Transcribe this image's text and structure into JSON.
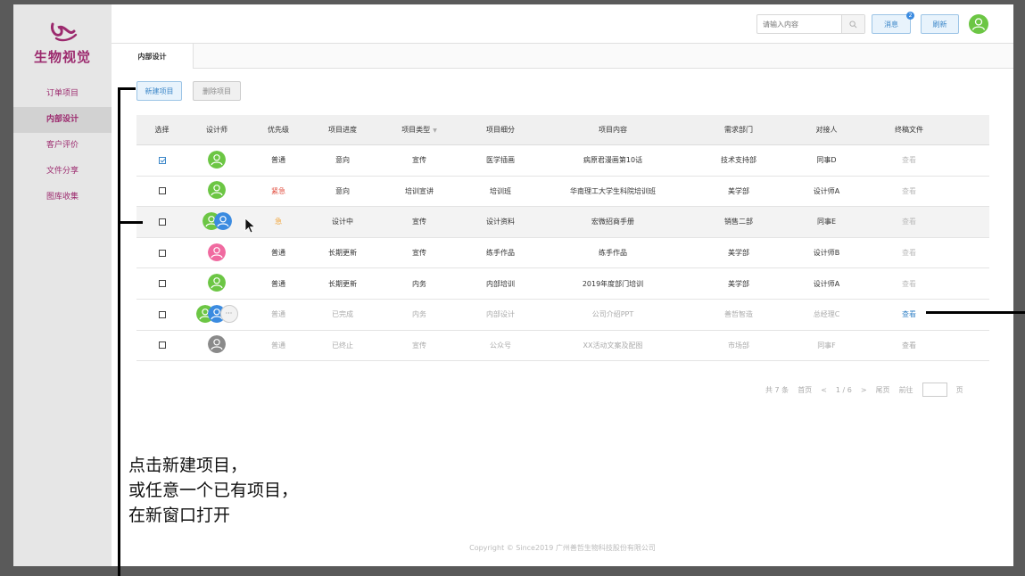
{
  "brand": {
    "name": "生物视觉",
    "color": "#9c2a6e"
  },
  "sidebar": {
    "items": [
      {
        "label": "订单项目",
        "active": false
      },
      {
        "label": "内部设计",
        "active": true
      },
      {
        "label": "客户评价",
        "active": false
      },
      {
        "label": "文件分享",
        "active": false
      },
      {
        "label": "图库收集",
        "active": false
      }
    ]
  },
  "topbar": {
    "search_placeholder": "请输入内容",
    "message_label": "消息",
    "message_badge": "2",
    "refresh_label": "刷新"
  },
  "tabs": [
    {
      "label": "内部设计"
    }
  ],
  "actions": {
    "new_label": "新建项目",
    "delete_label": "删除项目"
  },
  "table": {
    "headers": [
      "选择",
      "设计师",
      "优先级",
      "项目进度",
      "项目类型",
      "项目细分",
      "项目内容",
      "需求部门",
      "对接人",
      "终稿文件"
    ],
    "rows": [
      {
        "checked": true,
        "priority": "普通",
        "progress": "意向",
        "type": "宣传",
        "sub": "医学插画",
        "content": "病原君漫画第10话",
        "dept": "技术支持部",
        "contact": "同事D",
        "file": "查看"
      },
      {
        "checked": false,
        "priority": "紧急",
        "progress": "意向",
        "type": "培训宣讲",
        "sub": "培训班",
        "content": "华南理工大学生科院培训班",
        "dept": "美学部",
        "contact": "设计师A",
        "file": "查看"
      },
      {
        "checked": false,
        "priority": "急",
        "progress": "设计中",
        "type": "宣传",
        "sub": "设计资料",
        "content": "宏微招商手册",
        "dept": "销售二部",
        "contact": "同事E",
        "file": "查看"
      },
      {
        "checked": false,
        "priority": "普通",
        "progress": "长期更新",
        "type": "宣传",
        "sub": "练手作品",
        "content": "练手作品",
        "dept": "美学部",
        "contact": "设计师B",
        "file": "查看"
      },
      {
        "checked": false,
        "priority": "普通",
        "progress": "长期更新",
        "type": "内务",
        "sub": "内部培训",
        "content": "2019年度部门培训",
        "dept": "美学部",
        "contact": "设计师A",
        "file": "查看"
      },
      {
        "checked": false,
        "priority": "普通",
        "progress": "已完成",
        "type": "内务",
        "sub": "内部设计",
        "content": "公司介绍PPT",
        "dept": "善哲智造",
        "contact": "总经理C",
        "file": "查看"
      },
      {
        "checked": false,
        "priority": "普通",
        "progress": "已终止",
        "type": "宣传",
        "sub": "公众号",
        "content": "XX活动文案及配图",
        "dept": "市场部",
        "contact": "同事F",
        "file": "查看"
      }
    ]
  },
  "pager": {
    "total": "共 7 条",
    "first": "首页",
    "prev": "<",
    "page": "1 / 6",
    "next": ">",
    "last": "尾页",
    "goto": "前往",
    "page_unit": "页"
  },
  "footer": {
    "copyright": "Copyright © Since2019  广州善哲生物科技股份有限公司"
  },
  "annotation": {
    "line1": "点击新建项目，",
    "line2": "或任意一个已有项目，",
    "line3": "在新窗口打开"
  },
  "colors": {
    "accent": "#3a86c8",
    "urgent": "#e14b3c",
    "hot": "#f0a030",
    "avatar_green": "#6cc644",
    "avatar_blue": "#3b8be0",
    "avatar_pink": "#f06aa0",
    "avatar_gray": "#8a8a8a"
  }
}
